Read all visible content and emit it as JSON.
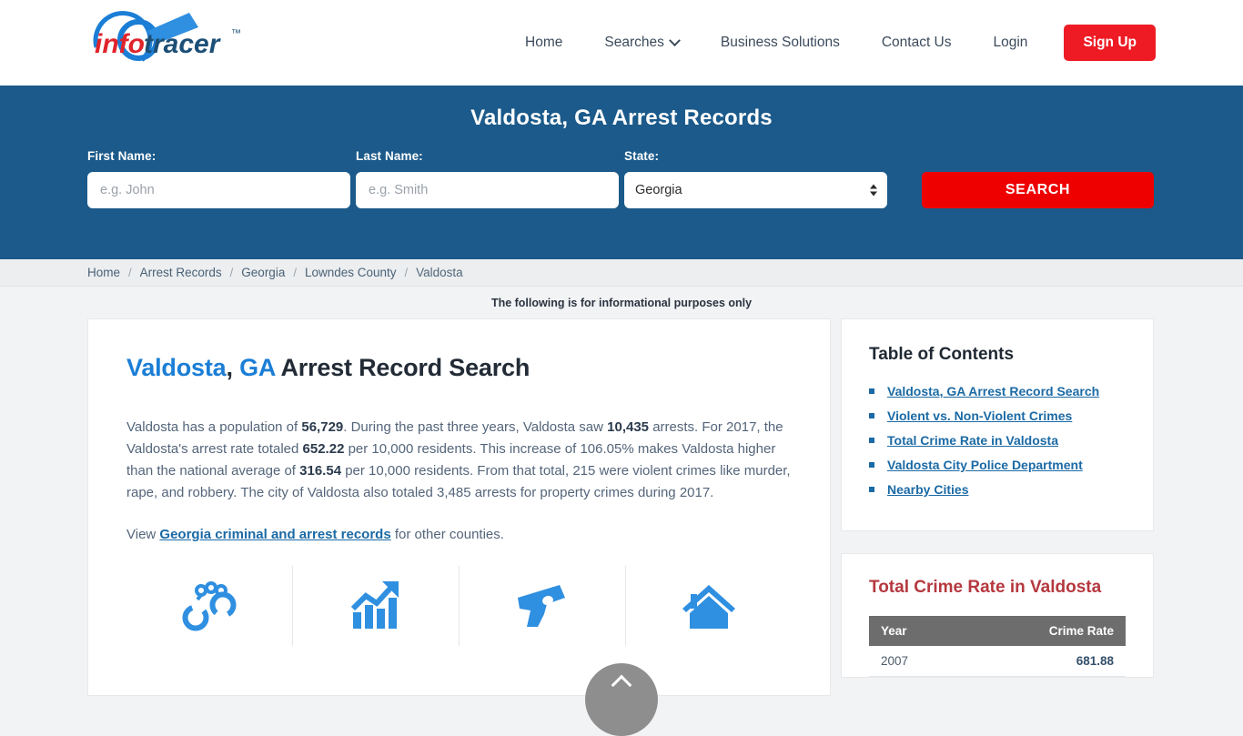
{
  "brand": {
    "logo_text_info": "info",
    "logo_text_tracer": "tracer",
    "logo_tm": "™",
    "color_red": "#ee1b24",
    "color_blue": "#1b7ed6",
    "color_band": "#1b5a8a"
  },
  "nav": {
    "items": [
      {
        "label": "Home",
        "has_caret": false
      },
      {
        "label": "Searches",
        "has_caret": true
      },
      {
        "label": "Business Solutions",
        "has_caret": false
      },
      {
        "label": "Contact Us",
        "has_caret": false
      },
      {
        "label": "Login",
        "has_caret": false
      }
    ],
    "signup_label": "Sign Up"
  },
  "hero": {
    "title": "Valdosta, GA Arrest Records",
    "first_name_label": "First Name:",
    "first_name_placeholder": "e.g. John",
    "first_name_value": "",
    "last_name_label": "Last Name:",
    "last_name_placeholder": "e.g. Smith",
    "last_name_value": "",
    "state_label": "State:",
    "state_selected": "Georgia",
    "state_options": [
      "Georgia"
    ],
    "search_label": "SEARCH"
  },
  "breadcrumb": {
    "separator": "/",
    "items": [
      "Home",
      "Arrest Records",
      "Georgia",
      "Lowndes County",
      "Valdosta"
    ]
  },
  "disclaimer": "The following is for informational purposes only",
  "main": {
    "heading_city": "Valdosta",
    "heading_comma": ",",
    "heading_state": "GA",
    "heading_rest": "Arrest Record Search",
    "paragraph": {
      "s1": "Valdosta has a population of ",
      "b1": "56,729",
      "s2": ". During the past three years, Valdosta saw ",
      "b2": "10,435",
      "s3": " arrests. For 2017, the Valdosta's arrest rate totaled ",
      "b3": "652.22",
      "s4": " per 10,000 residents. This increase of 106.05% makes Valdosta higher than the national average of ",
      "b4": "316.54",
      "s5": " per 10,000 residents. From that total, 215 were violent crimes like murder, rape, and robbery. The city of Valdosta also totaled 3,485 arrests for property crimes during 2017."
    },
    "view_prefix": "View ",
    "view_link": "Georgia criminal and arrest records",
    "view_suffix": " for other counties.",
    "icons": [
      {
        "name": "handcuffs-icon"
      },
      {
        "name": "growth-chart-icon"
      },
      {
        "name": "handgun-icon"
      },
      {
        "name": "house-icon"
      }
    ]
  },
  "sidebar": {
    "toc_title": "Table of Contents",
    "toc_items": [
      "Valdosta, GA Arrest Record Search",
      "Violent vs. Non-Violent Crimes",
      "Total Crime Rate in Valdosta",
      "Valdosta City Police Department",
      "Nearby Cities"
    ],
    "crime_title": "Total Crime Rate in Valdosta",
    "crime_headers": [
      "Year",
      "Crime Rate"
    ],
    "crime_rows": [
      {
        "year": "2007",
        "rate": "681.88"
      }
    ]
  },
  "chart_data": {
    "type": "table",
    "title": "Total Crime Rate in Valdosta",
    "categories": [
      "2007"
    ],
    "values": [
      681.88
    ],
    "xlabel": "Year",
    "ylabel": "Crime Rate"
  },
  "scroll_top": {
    "icon": "chevron-up-icon"
  }
}
